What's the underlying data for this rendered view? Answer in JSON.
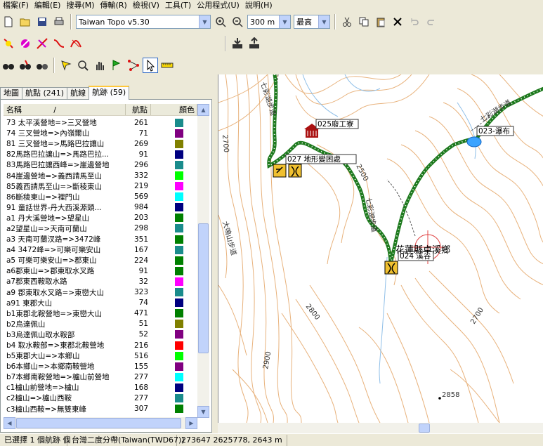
{
  "menubar": [
    "檔案(F)",
    "編輯(E)",
    "搜尋(M)",
    "傳輸(R)",
    "檢視(V)",
    "工具(T)",
    "公用程式(U)",
    "說明(H)"
  ],
  "toolbar": {
    "map_product": "Taiwan Topo v5.30",
    "zoom": "300 m",
    "detail": "最高"
  },
  "tabs": [
    "地圖",
    "航點 (241)",
    "航線",
    "航跡 (59)"
  ],
  "active_tab": "航跡 (59)",
  "list": {
    "headers": {
      "name": "名稱",
      "points": "航點",
      "color": "顏色"
    },
    "sort_indicator": "/",
    "rows": [
      {
        "name": "73 太平溪營地=>三叉營地",
        "points": "261",
        "color": "#1a8c8c"
      },
      {
        "name": "74 三叉營地=>內嶺爾山",
        "points": "71",
        "color": "#800080"
      },
      {
        "name": "81 三叉營地=>馬路巴拉讓山",
        "points": "269",
        "color": "#808000"
      },
      {
        "name": "82馬路巴拉讓山=>馬路巴拉...",
        "points": "91",
        "color": "#000080"
      },
      {
        "name": "83馬路巴拉讓西峰=>崖邊營地",
        "points": "296",
        "color": "#1a8c8c"
      },
      {
        "name": "84崖邊營地=>義西請馬至山",
        "points": "332",
        "color": "#00ff00"
      },
      {
        "name": "85義西請馬至山=>斷稜東山",
        "points": "219",
        "color": "#ff00ff"
      },
      {
        "name": "86斷稜東山=>裡門山",
        "points": "569",
        "color": "#00ffff"
      },
      {
        "name": "91 童話世界-丹大西溪源頭...",
        "points": "984",
        "color": "#000080"
      },
      {
        "name": "a1 丹大溪營地=>望星山",
        "points": "203",
        "color": "#008000"
      },
      {
        "name": "a2望星山=>天南可蘭山",
        "points": "298",
        "color": "#1a8c8c"
      },
      {
        "name": "a3 天南可蘭汊路=>3472峰",
        "points": "351",
        "color": "#008000"
      },
      {
        "name": "a4 3472峰=>可樂可樂安山",
        "points": "167",
        "color": "#1a8c8c"
      },
      {
        "name": "a5 可樂可樂安山=>郡東山",
        "points": "224",
        "color": "#008000"
      },
      {
        "name": "a6郡東山=>郡東取水叉路",
        "points": "91",
        "color": "#008000"
      },
      {
        "name": "a7郡東西鞍取水路",
        "points": "32",
        "color": "#ff00ff"
      },
      {
        "name": "a9 郡東取水叉路=>東巒大山",
        "points": "323",
        "color": "#1a8c8c"
      },
      {
        "name": "a91 東郡大山",
        "points": "74",
        "color": "#000080"
      },
      {
        "name": "b1東郡北鞍營地=>東巒大山",
        "points": "471",
        "color": "#008000"
      },
      {
        "name": "b2烏達佩山",
        "points": "51",
        "color": "#808000"
      },
      {
        "name": "b3烏達佩山取水鞍部",
        "points": "52",
        "color": "#800080"
      },
      {
        "name": "b4 取水鞍部=>東郡北鞍營地",
        "points": "216",
        "color": "#ff0000"
      },
      {
        "name": "b5東郡大山=>本鄉山",
        "points": "516",
        "color": "#00ff00"
      },
      {
        "name": "b6本鄉山=>本鄉南鞍營地",
        "points": "155",
        "color": "#800080"
      },
      {
        "name": "b7本鄉南鞍營地=>櫨山前營地",
        "points": "277",
        "color": "#00ffff"
      },
      {
        "name": "c1櫨山前營地=>櫨山",
        "points": "168",
        "color": "#000080"
      },
      {
        "name": "c2櫨山=>櫨山西鞍",
        "points": "277",
        "color": "#1a8c8c"
      },
      {
        "name": "c3櫨山西鞍=>無雙東峰",
        "points": "307",
        "color": "#008000"
      }
    ]
  },
  "map": {
    "labels": {
      "a": "025廢工寮",
      "b": "027 地形變困處",
      "c": "023-瀑布",
      "d": "024 溪谷",
      "e": "花蓮縣卓溪鄉",
      "f": "七彩湖步道",
      "g": "七彩湖步道",
      "h": "七彩湖步道",
      "i": "大鳴山步道",
      "j": "2500",
      "k": "2800",
      "l": "2700",
      "m": "2900",
      "n": "2858",
      "o": "2700"
    }
  },
  "status": {
    "selection": "已選擇 1 個航跡 個",
    "datum": "台灣二度分帶(Taiwan(TWD67))",
    "coords": "273647 2625778, 2643 m"
  }
}
